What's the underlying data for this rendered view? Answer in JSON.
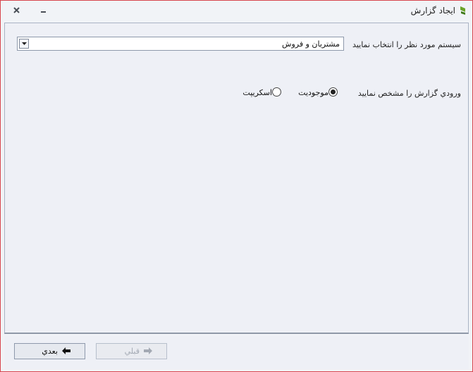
{
  "window": {
    "title": "ایجاد گزارش",
    "close_glyph": "X",
    "minimize_glyph": "_"
  },
  "form": {
    "system_label": "سیستم مورد نظر را انتخاب نمایید",
    "system_value": "مشتریان و فروش",
    "input_label": "ورودي گزارش را مشخص نمایید",
    "radio_options": [
      {
        "label": "موجودیت",
        "selected": true
      },
      {
        "label": "اسکریپت",
        "selected": false
      }
    ]
  },
  "footer": {
    "next_label": "بعدي",
    "prev_label": "قبلي"
  },
  "colors": {
    "window_border": "#d8464f",
    "background": "#eef0f6",
    "accent": "#4a8a1c"
  }
}
